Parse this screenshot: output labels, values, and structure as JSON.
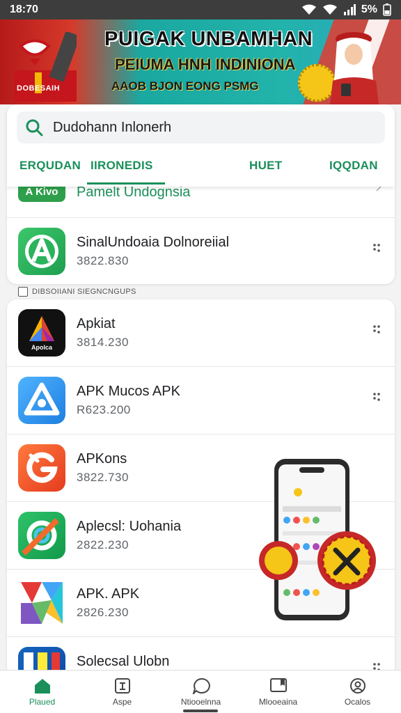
{
  "status_bar": {
    "time": "18:70",
    "battery": "5%"
  },
  "banner": {
    "title": "PUIGAK UNBAMHAN",
    "subtitle": "PEIUMA HNH INDINIONA",
    "tagline": "AAOB BJON EONG PSMG",
    "logo_label": "DOBESAIH"
  },
  "search": {
    "value": "Dudohann Inlonerh",
    "icon": "search-icon"
  },
  "tabs": [
    {
      "label": "ERQUDAN"
    },
    {
      "label": "IIRONEDIS",
      "active": true
    },
    {
      "label": "HUET"
    },
    {
      "label": "IQQDAN"
    }
  ],
  "top_list": [
    {
      "icon_label": "A Kivo",
      "name": "Pamelt Undognsia"
    },
    {
      "name": "SinalUndoaia Dolnoreiial",
      "meta": "3822.830"
    }
  ],
  "section_label": "DIBSOIIANI SIEGNCNGUPS",
  "apps": [
    {
      "name": "Apkiat",
      "meta": "3814.230",
      "icon_caption": "Apolca"
    },
    {
      "name": "APK Mucos APK",
      "meta": "R623.200"
    },
    {
      "name": "APKons",
      "meta": "3822.730"
    },
    {
      "name": "Aplecsl: Uohania",
      "meta": "2822.230"
    },
    {
      "name": "APK. APK",
      "meta": "2826.230"
    },
    {
      "name": "Solecsal Ulobn",
      "meta": ""
    }
  ],
  "bottom_nav": [
    {
      "label": "Plaued",
      "icon": "home-icon",
      "active": true
    },
    {
      "label": "Aspe",
      "icon": "apps-icon"
    },
    {
      "label": "Ntiooelnna",
      "icon": "chat-icon"
    },
    {
      "label": "Mlooeaina",
      "icon": "bookmark-icon"
    },
    {
      "label": "Ocalos",
      "icon": "profile-icon"
    }
  ],
  "colors": {
    "accent": "#1a8f5a",
    "banner_red": "#d63a2b",
    "banner_teal": "#22b3ab"
  }
}
